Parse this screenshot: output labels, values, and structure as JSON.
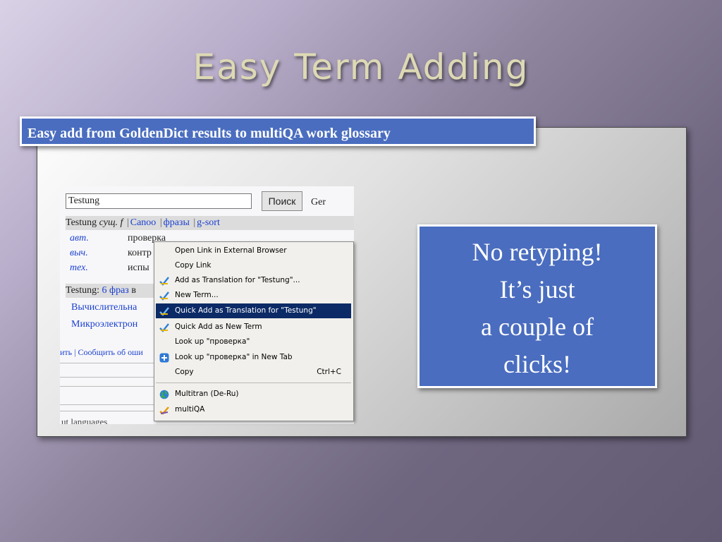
{
  "title": "Easy Term Adding",
  "caption": "Easy add from GoldenDict results to multiQA work glossary",
  "screenshot": {
    "search_value": "Testung",
    "search_button": "Поиск",
    "language": "Ger",
    "headword": "Testung",
    "pos": "сущ. f",
    "links": [
      "Canoo",
      "фразы",
      "g-sort"
    ],
    "rows": [
      {
        "abbr": "авт.",
        "text": "проверка"
      },
      {
        "abbr": "выч.",
        "text": "контр"
      },
      {
        "abbr": "тех.",
        "text": "испы"
      }
    ],
    "phrases_prefix": "Testung:",
    "phrases_count": "6 фраз",
    "phrases_suffix": "в",
    "phrase_lines": [
      "Вычислительна",
      "Микроэлектрон"
    ],
    "footer_links": "ить | Сообщить об оши",
    "clipped_text": "ut  languages"
  },
  "context_menu": {
    "items": [
      {
        "label": "Open Link in External Browser",
        "icon": ""
      },
      {
        "label": "Copy Link",
        "icon": ""
      },
      {
        "label": "Add as Translation for \"Testung\"...",
        "icon": "multiqa-check-icon"
      },
      {
        "label": "New Term...",
        "icon": "multiqa-check-icon"
      },
      {
        "label": "Quick Add as Translation for \"Testung\"",
        "icon": "multiqa-check-icon",
        "selected": true
      },
      {
        "label": "Quick Add as New Term",
        "icon": "multiqa-check-icon"
      },
      {
        "label": "Look up \"проверка\"",
        "icon": ""
      },
      {
        "label": "Look up \"проверка\" in New Tab",
        "icon": "plus-tab-icon"
      },
      {
        "label": "Copy",
        "icon": "",
        "shortcut": "Ctrl+C"
      },
      {
        "label": "Multitran (De-Ru)",
        "icon": "globe-icon"
      },
      {
        "label": "multiQA",
        "icon": "multiqa-logo-icon"
      }
    ]
  },
  "callout": {
    "lines": [
      "No retyping!",
      "It’s just",
      "a couple of",
      "clicks!"
    ]
  },
  "colors": {
    "accent_blue": "#4a6dbf",
    "menu_highlight": "#0b2a66",
    "title_color": "#ddd9b4",
    "link_blue": "#1a3fd0"
  }
}
